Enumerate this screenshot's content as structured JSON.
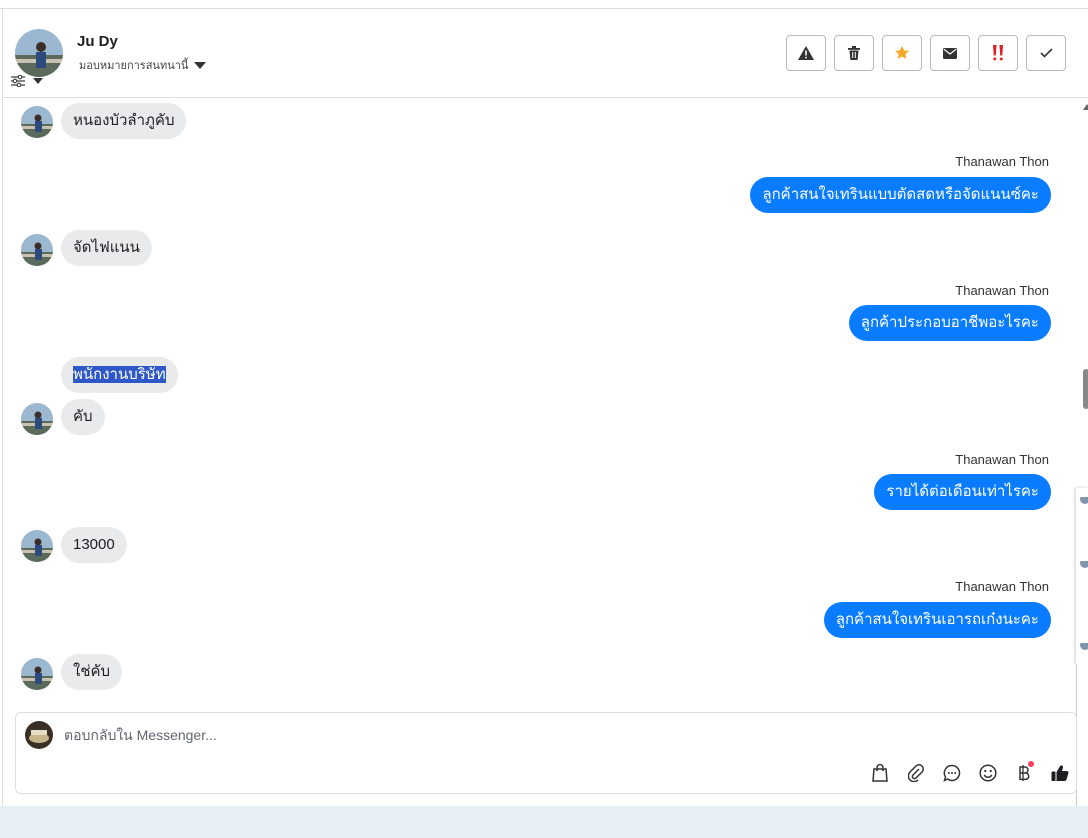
{
  "header": {
    "name": "Ju Dy",
    "assign_label": "มอบหมายการสนทนานี้",
    "actions": [
      {
        "id": "spam",
        "icon": "warning-icon"
      },
      {
        "id": "delete",
        "icon": "trash-icon"
      },
      {
        "id": "star",
        "icon": "star-icon"
      },
      {
        "id": "unread",
        "icon": "envelope-icon"
      },
      {
        "id": "important",
        "icon": "double-exclamation-icon"
      },
      {
        "id": "done",
        "icon": "checkmark-icon"
      }
    ]
  },
  "messages": {
    "m1": "หนองบัวลำภูคับ",
    "s1": "Thanawan Thon",
    "m2": "ลูกค้าสนใจเทรินแบบตัดสดหรือจัดแนนซ์คะ",
    "m3": "จัดไฟแนน",
    "s2": "Thanawan Thon",
    "m4": "ลูกค้าประกอบอาชีพอะไรคะ",
    "m5": "พนักงานบริษัท",
    "m6": "คับ",
    "s3": "Thanawan Thon",
    "m7": "รายได้ต่อเดือนเท่าไรคะ",
    "m8": "13000",
    "s4": "Thanawan Thon",
    "m9": "ลูกค้าสนใจเทรินเอารถเก๋งนะคะ",
    "m10": "ใช่คับ"
  },
  "composer": {
    "placeholder": "ตอบกลับใน Messenger...",
    "tools": [
      "shopping-bag-icon",
      "paperclip-icon",
      "chat-bubble-icon",
      "emoji-icon",
      "baht-icon",
      "thumbs-up-icon"
    ]
  },
  "colors": {
    "outgoing_bubble": "#0a7cff",
    "incoming_bubble": "#e9eaec",
    "star": "#f5a623",
    "important": "#e02020",
    "selection": "#2e58c8"
  }
}
